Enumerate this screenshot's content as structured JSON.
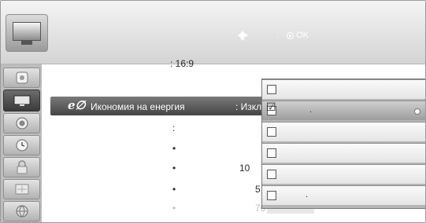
{
  "header": {
    "nav_hint": ".",
    "ok_label": "OK"
  },
  "sidebar": {
    "items": [
      {
        "icon": "picture-icon"
      },
      {
        "icon": "tv-icon"
      },
      {
        "icon": "speaker-icon"
      },
      {
        "icon": "clock-icon"
      },
      {
        "icon": "lock-icon"
      },
      {
        "icon": "option-icon"
      },
      {
        "icon": "network-icon"
      }
    ]
  },
  "settings": {
    "aspect_ratio": ": 16:9",
    "energy_label": "Икономия на енергия",
    "energy_value": ": Изкл",
    "colon_row": ":",
    "bullet_row_1": "•",
    "bullet_row_2": "•",
    "bullet_row_3": "•",
    "bullet_row_4": "•",
    "value_1": "10",
    "value_2": "5",
    "value_3": "70"
  },
  "dropdown": {
    "options": [
      {
        "label": "",
        "checked": false
      },
      {
        "label": ".",
        "checked": true
      },
      {
        "label": "",
        "checked": false
      },
      {
        "label": "",
        "checked": false
      },
      {
        "label": "",
        "checked": false
      },
      {
        "label": ".",
        "checked": false
      }
    ],
    "check_glyph": "☑"
  }
}
